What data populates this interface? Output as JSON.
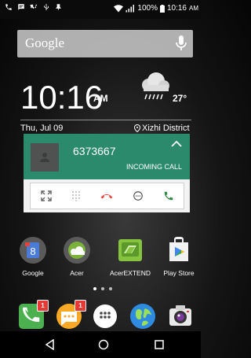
{
  "status": {
    "battery_percent": "100%",
    "time": "10:16",
    "ampm": "AM"
  },
  "search": {
    "logo": "Google"
  },
  "clock": {
    "time": "10:16",
    "ampm": "AM",
    "date": "Thu, Jul 09",
    "location": "Xizhi District",
    "temperature": "27°"
  },
  "notification": {
    "number": "6373667",
    "status": "INCOMING CALL",
    "accent": "#2b8a6c"
  },
  "apps": [
    {
      "label": "Google",
      "icon": "google-folder-icon"
    },
    {
      "label": "Acer",
      "icon": "acer-folder-icon"
    },
    {
      "label": "AcerEXTEND",
      "icon": "acerextend-icon"
    },
    {
      "label": "Play Store",
      "icon": "play-store-icon"
    }
  ],
  "dock": [
    {
      "icon": "phone-icon",
      "badge": "1"
    },
    {
      "icon": "messaging-icon",
      "badge": "1"
    },
    {
      "icon": "app-drawer-icon",
      "badge": ""
    },
    {
      "icon": "browser-icon",
      "badge": ""
    },
    {
      "icon": "camera-icon",
      "badge": ""
    }
  ]
}
